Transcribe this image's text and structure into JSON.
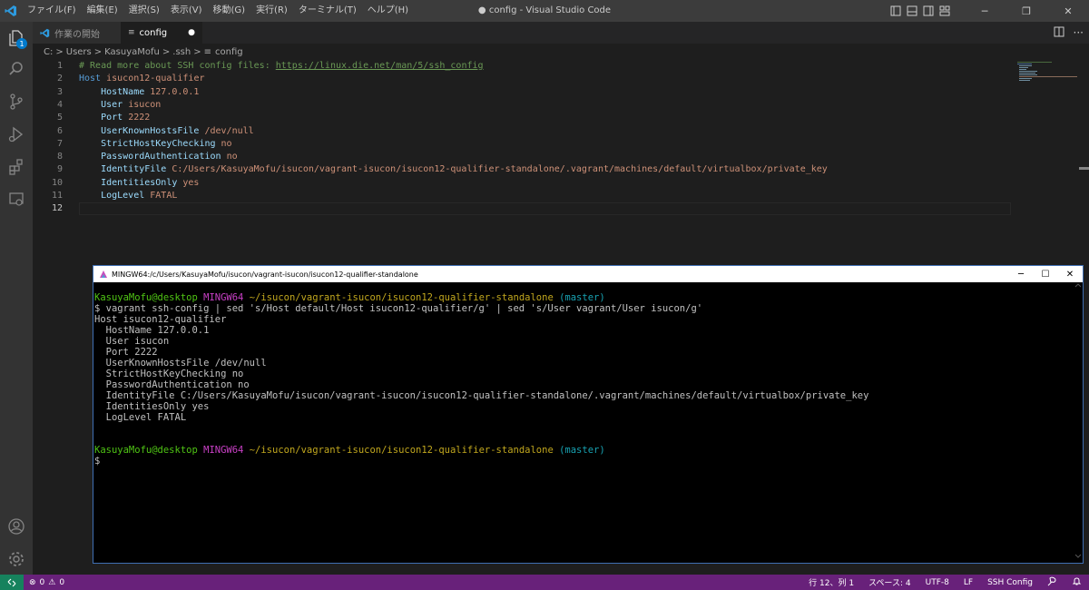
{
  "window": {
    "title": "● config - Visual Studio Code",
    "menu": [
      "ファイル(F)",
      "編集(E)",
      "選択(S)",
      "表示(V)",
      "移動(G)",
      "実行(R)",
      "ターミナル(T)",
      "ヘルプ(H)"
    ]
  },
  "activity": {
    "explorer_badge": "1"
  },
  "tabs": [
    {
      "label": "作業の開始",
      "icon": "vscode-logo-icon",
      "active": false
    },
    {
      "label": "config",
      "icon": "settings-file-icon",
      "active": true,
      "dirty_marker": "●"
    }
  ],
  "breadcrumb": [
    "C:",
    "Users",
    "KasuyaMofu",
    ".ssh",
    "config"
  ],
  "breadcrumb_sep": ">",
  "editor": {
    "lines": [
      {
        "num": "1",
        "parts": [
          {
            "t": "# Read more about SSH config files: ",
            "c": "com"
          },
          {
            "t": "https://linux.die.net/man/5/ssh_config",
            "c": "link"
          }
        ]
      },
      {
        "num": "2",
        "parts": [
          {
            "t": "Host",
            "c": "host"
          },
          {
            "t": " isucon12-qualifier",
            "c": "val"
          }
        ]
      },
      {
        "num": "3",
        "parts": [
          {
            "t": "    HostName",
            "c": "key"
          },
          {
            "t": " 127.0.0.1",
            "c": "val"
          }
        ]
      },
      {
        "num": "4",
        "parts": [
          {
            "t": "    User",
            "c": "key"
          },
          {
            "t": " isucon",
            "c": "val"
          }
        ]
      },
      {
        "num": "5",
        "parts": [
          {
            "t": "    Port",
            "c": "key"
          },
          {
            "t": " 2222",
            "c": "val"
          }
        ]
      },
      {
        "num": "6",
        "parts": [
          {
            "t": "    UserKnownHostsFile",
            "c": "key"
          },
          {
            "t": " /dev/null",
            "c": "val"
          }
        ]
      },
      {
        "num": "7",
        "parts": [
          {
            "t": "    StrictHostKeyChecking",
            "c": "key"
          },
          {
            "t": " no",
            "c": "val"
          }
        ]
      },
      {
        "num": "8",
        "parts": [
          {
            "t": "    PasswordAuthentication",
            "c": "key"
          },
          {
            "t": " no",
            "c": "val"
          }
        ]
      },
      {
        "num": "9",
        "parts": [
          {
            "t": "    IdentityFile",
            "c": "key"
          },
          {
            "t": " C:/Users/KasuyaMofu/isucon/vagrant-isucon/isucon12-qualifier-standalone/.vagrant/machines/default/virtualbox/private_key",
            "c": "val"
          }
        ]
      },
      {
        "num": "10",
        "parts": [
          {
            "t": "    IdentitiesOnly",
            "c": "key"
          },
          {
            "t": " yes",
            "c": "val"
          }
        ]
      },
      {
        "num": "11",
        "parts": [
          {
            "t": "    LogLevel",
            "c": "key"
          },
          {
            "t": " FATAL",
            "c": "val"
          }
        ]
      },
      {
        "num": "12",
        "parts": []
      }
    ],
    "current_line": "12"
  },
  "terminal": {
    "title": "MINGW64:/c/Users/KasuyaMofu/isucon/vagrant-isucon/isucon12-qualifier-standalone",
    "window_controls": [
      "─",
      "☐",
      "✕"
    ],
    "lines": [
      [
        {
          "t": "KasuyaMofu@desktop",
          "c": "green"
        },
        {
          "t": " ",
          "c": ""
        },
        {
          "t": "MINGW64",
          "c": "mag"
        },
        {
          "t": " ",
          "c": ""
        },
        {
          "t": "~/isucon/vagrant-isucon/isucon12-qualifier-standalone",
          "c": "yel"
        },
        {
          "t": " ",
          "c": ""
        },
        {
          "t": "(master)",
          "c": "cyan"
        }
      ],
      [
        {
          "t": "$ vagrant ssh-config | sed 's/Host default/Host isucon12-qualifier/g' | sed 's/User vagrant/User isucon/g'",
          "c": ""
        }
      ],
      [
        {
          "t": "Host isucon12-qualifier",
          "c": ""
        }
      ],
      [
        {
          "t": "  HostName 127.0.0.1",
          "c": ""
        }
      ],
      [
        {
          "t": "  User isucon",
          "c": ""
        }
      ],
      [
        {
          "t": "  Port 2222",
          "c": ""
        }
      ],
      [
        {
          "t": "  UserKnownHostsFile /dev/null",
          "c": ""
        }
      ],
      [
        {
          "t": "  StrictHostKeyChecking no",
          "c": ""
        }
      ],
      [
        {
          "t": "  PasswordAuthentication no",
          "c": ""
        }
      ],
      [
        {
          "t": "  IdentityFile C:/Users/KasuyaMofu/isucon/vagrant-isucon/isucon12-qualifier-standalone/.vagrant/machines/default/virtualbox/private_key",
          "c": ""
        }
      ],
      [
        {
          "t": "  IdentitiesOnly yes",
          "c": ""
        }
      ],
      [
        {
          "t": "  LogLevel FATAL",
          "c": ""
        }
      ],
      [],
      [],
      [
        {
          "t": "KasuyaMofu@desktop",
          "c": "green"
        },
        {
          "t": " ",
          "c": ""
        },
        {
          "t": "MINGW64",
          "c": "mag"
        },
        {
          "t": " ",
          "c": ""
        },
        {
          "t": "~/isucon/vagrant-isucon/isucon12-qualifier-standalone",
          "c": "yel"
        },
        {
          "t": " ",
          "c": ""
        },
        {
          "t": "(master)",
          "c": "cyan"
        }
      ],
      [
        {
          "t": "$",
          "c": ""
        }
      ]
    ]
  },
  "statusbar": {
    "errors": "0",
    "warnings": "0",
    "position": "行 12、列 1",
    "spaces": "スペース: 4",
    "encoding": "UTF-8",
    "eol": "LF",
    "language": "SSH Config"
  },
  "colors": {
    "statusbar_bg": "#68217a",
    "remote_bg": "#16825d",
    "accent": "#007acc"
  }
}
